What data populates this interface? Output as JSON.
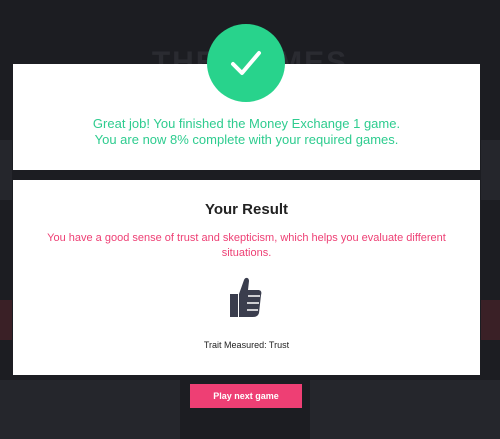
{
  "background": {
    "ghost_title": "THE GAMES"
  },
  "success_card": {
    "check_icon": "checkmark-icon",
    "line1": "Great job! You finished the Money Exchange 1 game.",
    "line2": "You are now 8% complete with your required games."
  },
  "result_card": {
    "title": "Your Result",
    "description": "You have a good sense of trust and skepticism, which helps you evaluate different situations.",
    "icon": "thumbs-up-icon",
    "trait": "Trait Measured: Trust"
  },
  "actions": {
    "play_next_label": "Play next game"
  },
  "colors": {
    "success_green": "#28d38c",
    "accent_pink": "#ee3f74",
    "backdrop": "#1a1b20"
  }
}
